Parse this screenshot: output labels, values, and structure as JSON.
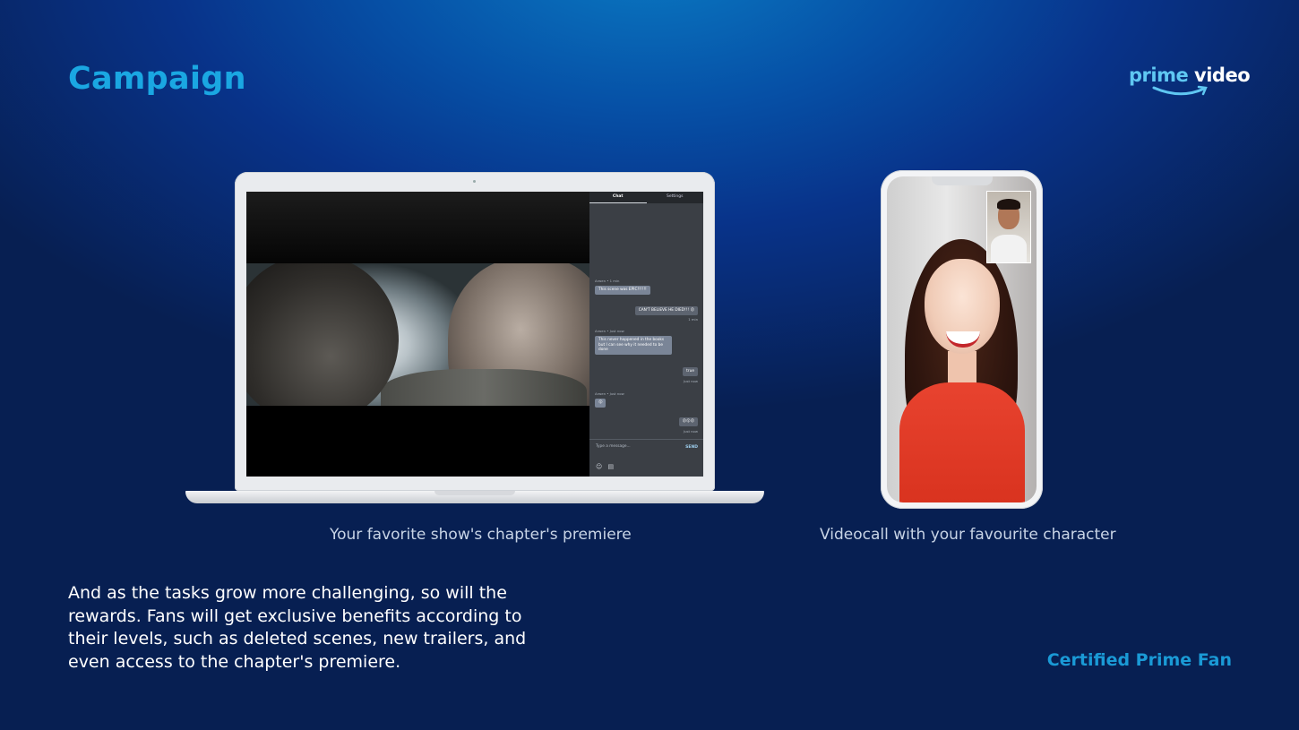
{
  "header": {
    "title": "Campaign"
  },
  "logo": {
    "word1": "prime",
    "word2": "video"
  },
  "laptop": {
    "caption": "Your favorite show's chapter's premiere",
    "chat": {
      "tabs": [
        "Chat",
        "Settings"
      ],
      "messages": [
        {
          "meta": "Arwen • 1 min",
          "text": "This scene was EPIC!!!!!!",
          "mine": false
        },
        {
          "meta": "1 min",
          "text": "CAN'T BELIEVE HE DIED!!! 😮",
          "mine": true
        },
        {
          "meta": "Arwen • Just now",
          "text": "This never happened in the books but I can see why it needed to be done",
          "mine": false
        },
        {
          "meta": "Just now",
          "text": "true",
          "mine": true
        },
        {
          "meta": "Arwen • Just now",
          "text": "😮",
          "mine": false
        },
        {
          "meta": "Just now",
          "text": "😮😮😮",
          "mine": true
        }
      ],
      "input_placeholder": "Type a message...",
      "send_label": "SEND"
    }
  },
  "phone": {
    "caption": "Videocall with your favourite character"
  },
  "body": {
    "text": "And as the tasks grow more challenging, so will the rewards. Fans will get exclusive benefits according to their levels, such as deleted scenes, new trailers, and even access to the chapter's premiere."
  },
  "tagline": "Certified Prime Fan",
  "colors": {
    "accent": "#1aa7e2",
    "background_top": "#0a7cc4",
    "background_bottom": "#071f52"
  }
}
